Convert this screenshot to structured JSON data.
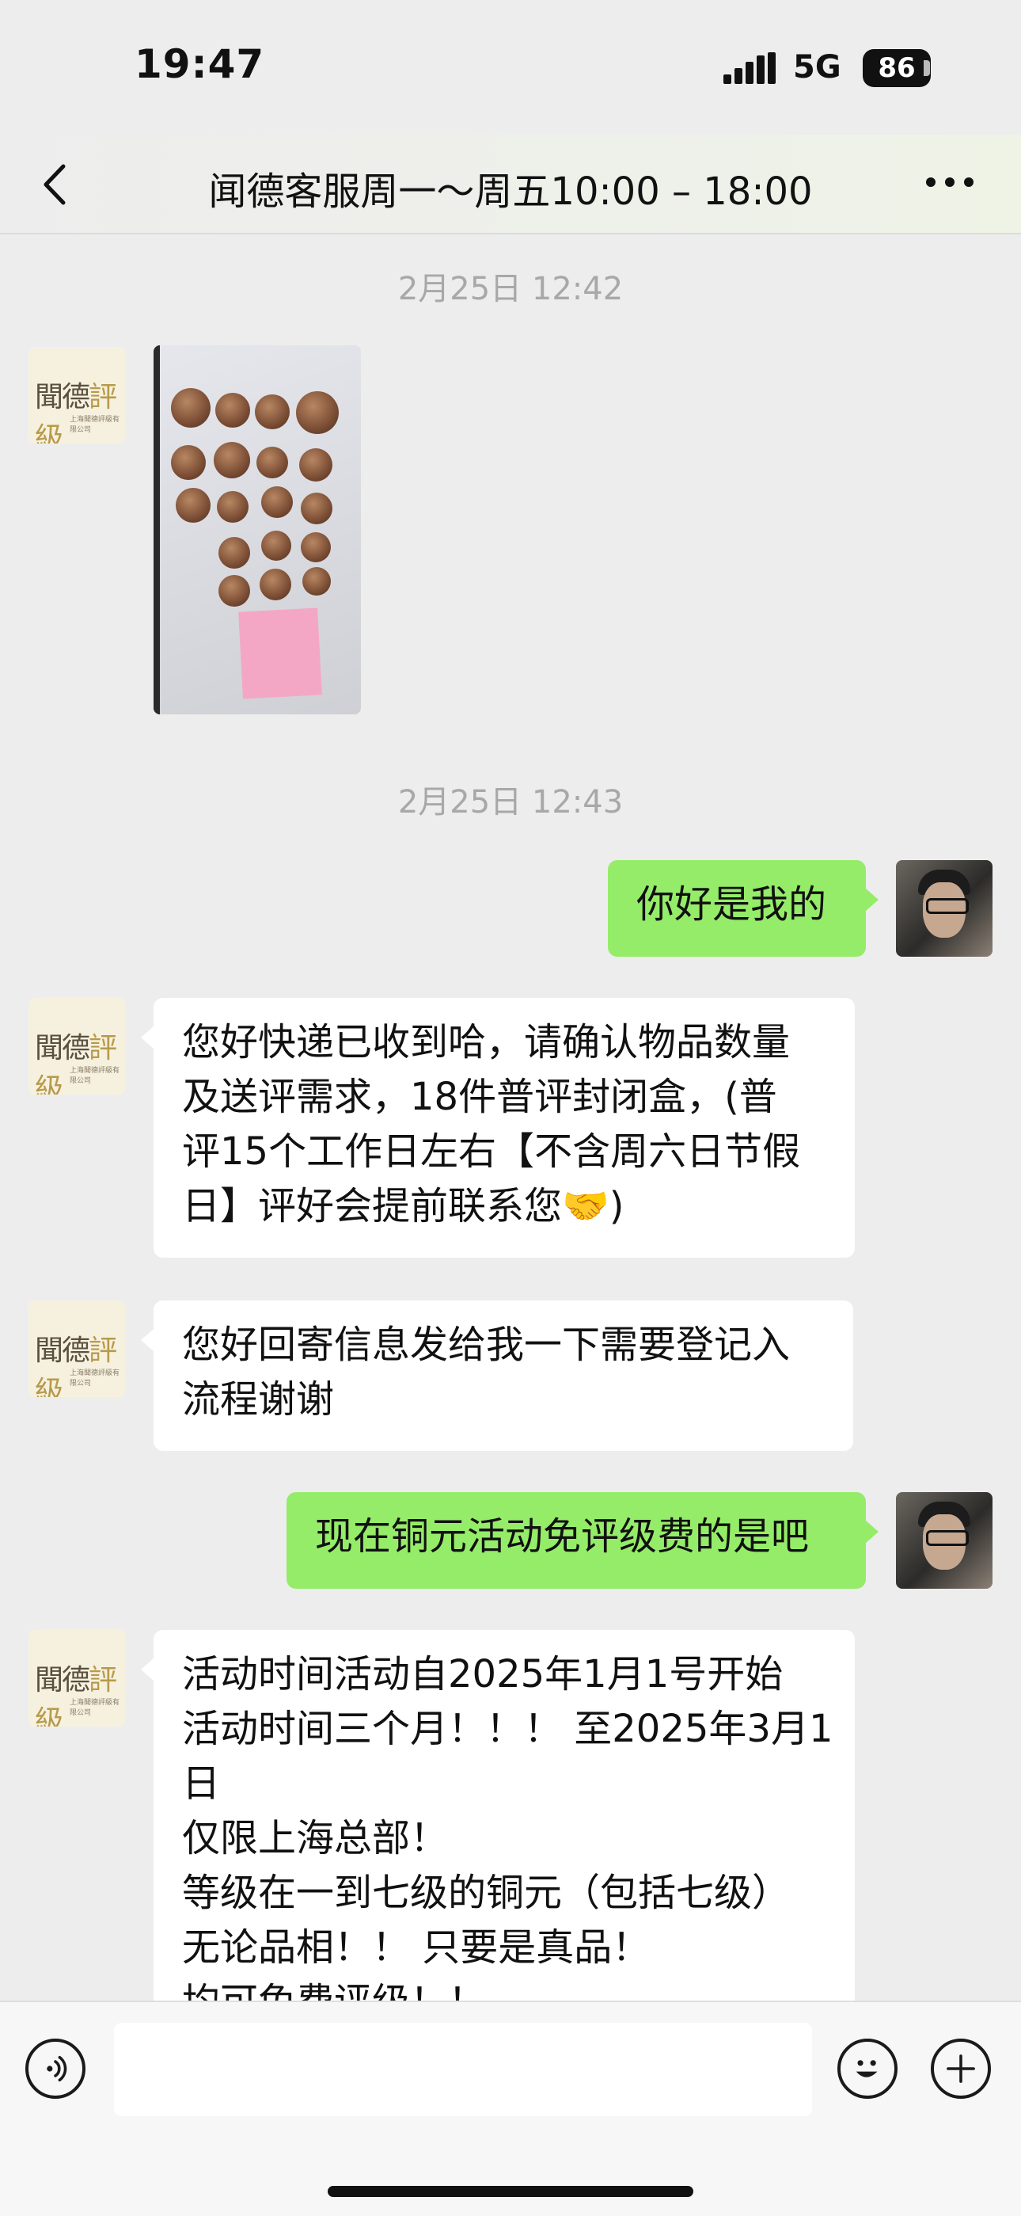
{
  "status_bar": {
    "time": "19:47",
    "network": "5G",
    "battery": "86"
  },
  "header": {
    "title": "闻德客服周一～周五10:00 – 18:00"
  },
  "agent_avatar": {
    "logo_text": "聞德",
    "logo_accent": "評級",
    "tagline": "上海聞德評級有限公司"
  },
  "messages": {
    "ts1": "2月25日 12:42",
    "ts2": "2月25日 12:43",
    "m1": "你好是我的",
    "m2": [
      "您好快递已收到哈，请确认物品数量",
      "及送评需求，18件普评封闭盒，(普",
      "评15个工作日左右【不含周六日节假",
      "日】评好会提前联系您🤝)"
    ],
    "m3": [
      "您好回寄信息发给我一下需要登记入",
      "流程谢谢"
    ],
    "m4": "现在铜元活动免评级费的是吧",
    "m5": [
      "活动时间活动自2025年1月1号开始",
      "活动时间三个月！！！ 至2025年3月1",
      "日",
      "仅限上海总部！",
      "等级在一到七级的铜元（包括七级）",
      "无论品相！！ 只要是真品！",
      "均可免费评级！！"
    ]
  },
  "colors": {
    "outgoing_bubble": "#95ec69",
    "incoming_bubble": "#ffffff",
    "background": "#ededed"
  }
}
